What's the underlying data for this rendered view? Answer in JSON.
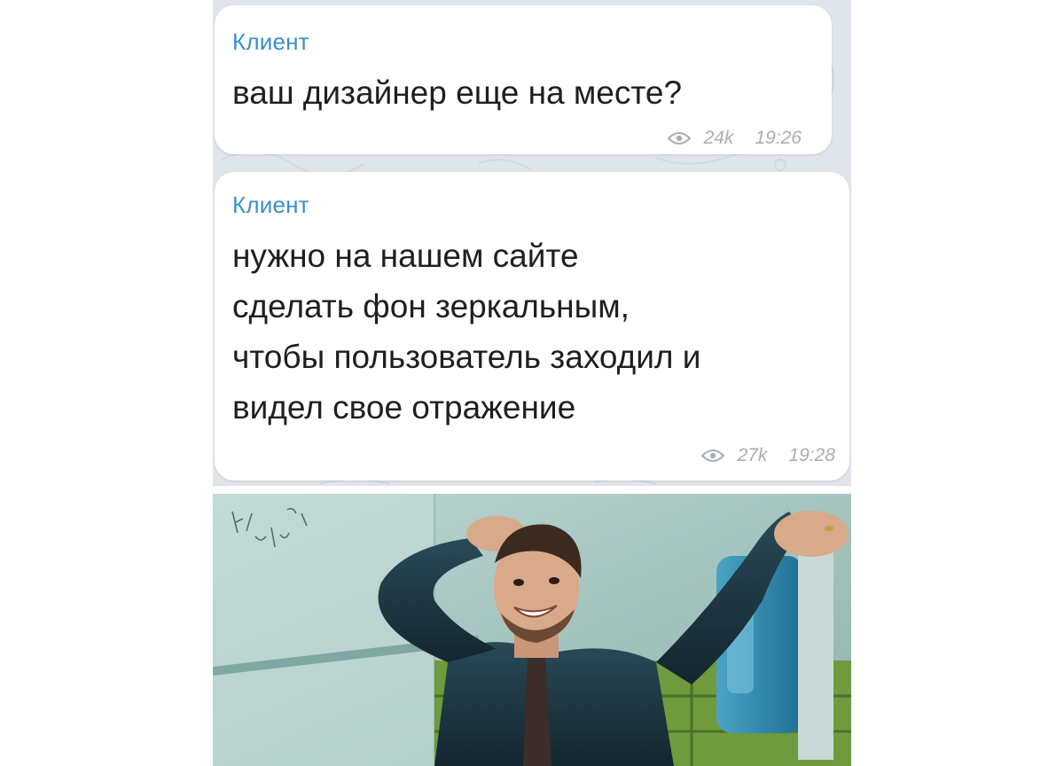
{
  "messages": [
    {
      "sender": "Клиент",
      "text": "ваш дизайнер еще на месте?",
      "views": "24k",
      "time": "19:26"
    },
    {
      "sender": "Клиент",
      "text": "нужно на нашем сайте\nсделать фон зеркальным,\nчтобы пользователь заходил и\nвидел свое отражение",
      "views": "27k",
      "time": "19:28"
    }
  ],
  "photo": {
    "icon": "reaction-photo",
    "colors": {
      "wall": "#a9c9c4",
      "tile_green": "#6f9a3d",
      "shirt": "#1c3440",
      "dispenser": "#2d7fa2"
    }
  },
  "colors": {
    "sender_name": "#3a8fc9",
    "chat_background": "#dfe5ea",
    "meta_text": "#a9aeb4"
  }
}
